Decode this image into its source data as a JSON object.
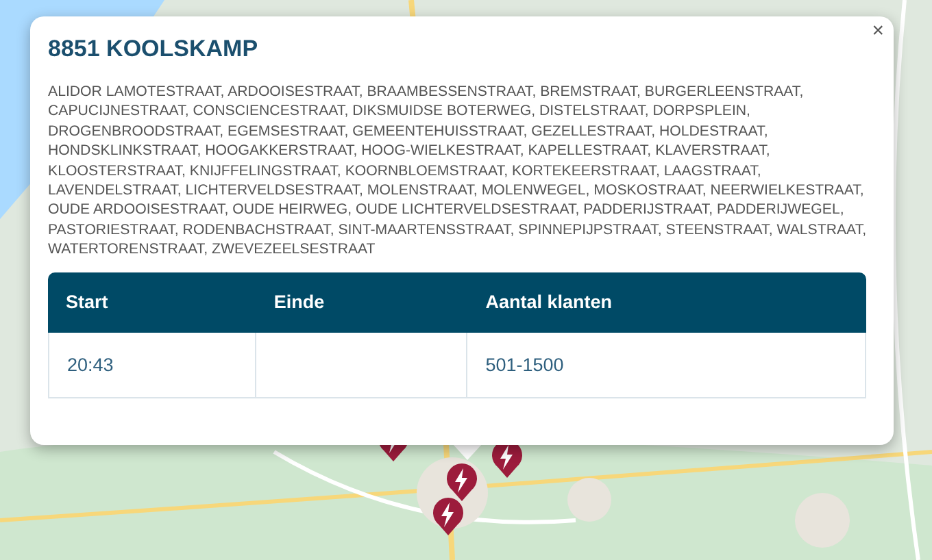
{
  "popup": {
    "title": "8851 KOOLSKAMP",
    "close": "×",
    "streets": "ALIDOR LAMOTESTRAAT, ARDOOISESTRAAT, BRAAMBESSENSTRAAT, BREMSTRAAT, BURGERLEENSTRAAT, CAPUCIJNESTRAAT, CONSCIENCESTRAAT, DIKSMUIDSE BOTERWEG, DISTELSTRAAT, DORPSPLEIN, DROGENBROODSTRAAT, EGEMSESTRAAT, GEMEENTEHUISSTRAAT, GEZELLESTRAAT, HOLDESTRAAT, HONDSKLINKSTRAAT, HOOGAKKERSTRAAT, HOOG-WIELKESTRAAT, KAPELLESTRAAT, KLAVERSTRAAT, KLOOSTERSTRAAT, KNIJFFELINGSTRAAT, KOORNBLOEMSTRAAT, KORTEKEERSTRAAT, LAAGSTRAAT, LAVENDELSTRAAT, LICHTERVELDSESTRAAT, MOLENSTRAAT, MOLENWEGEL, MOSKOSTRAAT, NEERWIELKESTRAAT, OUDE ARDOOISESTRAAT, OUDE HEIRWEG, OUDE LICHTERVELDSESTRAAT, PADDERIJSTRAAT, PADDERIJWEGEL, PASTORIESTRAAT, RODENBACHSTRAAT, SINT-MAARTENSSTRAAT, SPINNEPIJPSTRAAT, STEENSTRAAT, WALSTRAAT, WATERTORENSTRAAT, ZWEVEZEELSESTRAAT",
    "table": {
      "columns": [
        "Start",
        "Einde",
        "Aantal klanten"
      ],
      "rows": [
        [
          "20:43",
          "",
          "501-1500"
        ]
      ]
    }
  }
}
